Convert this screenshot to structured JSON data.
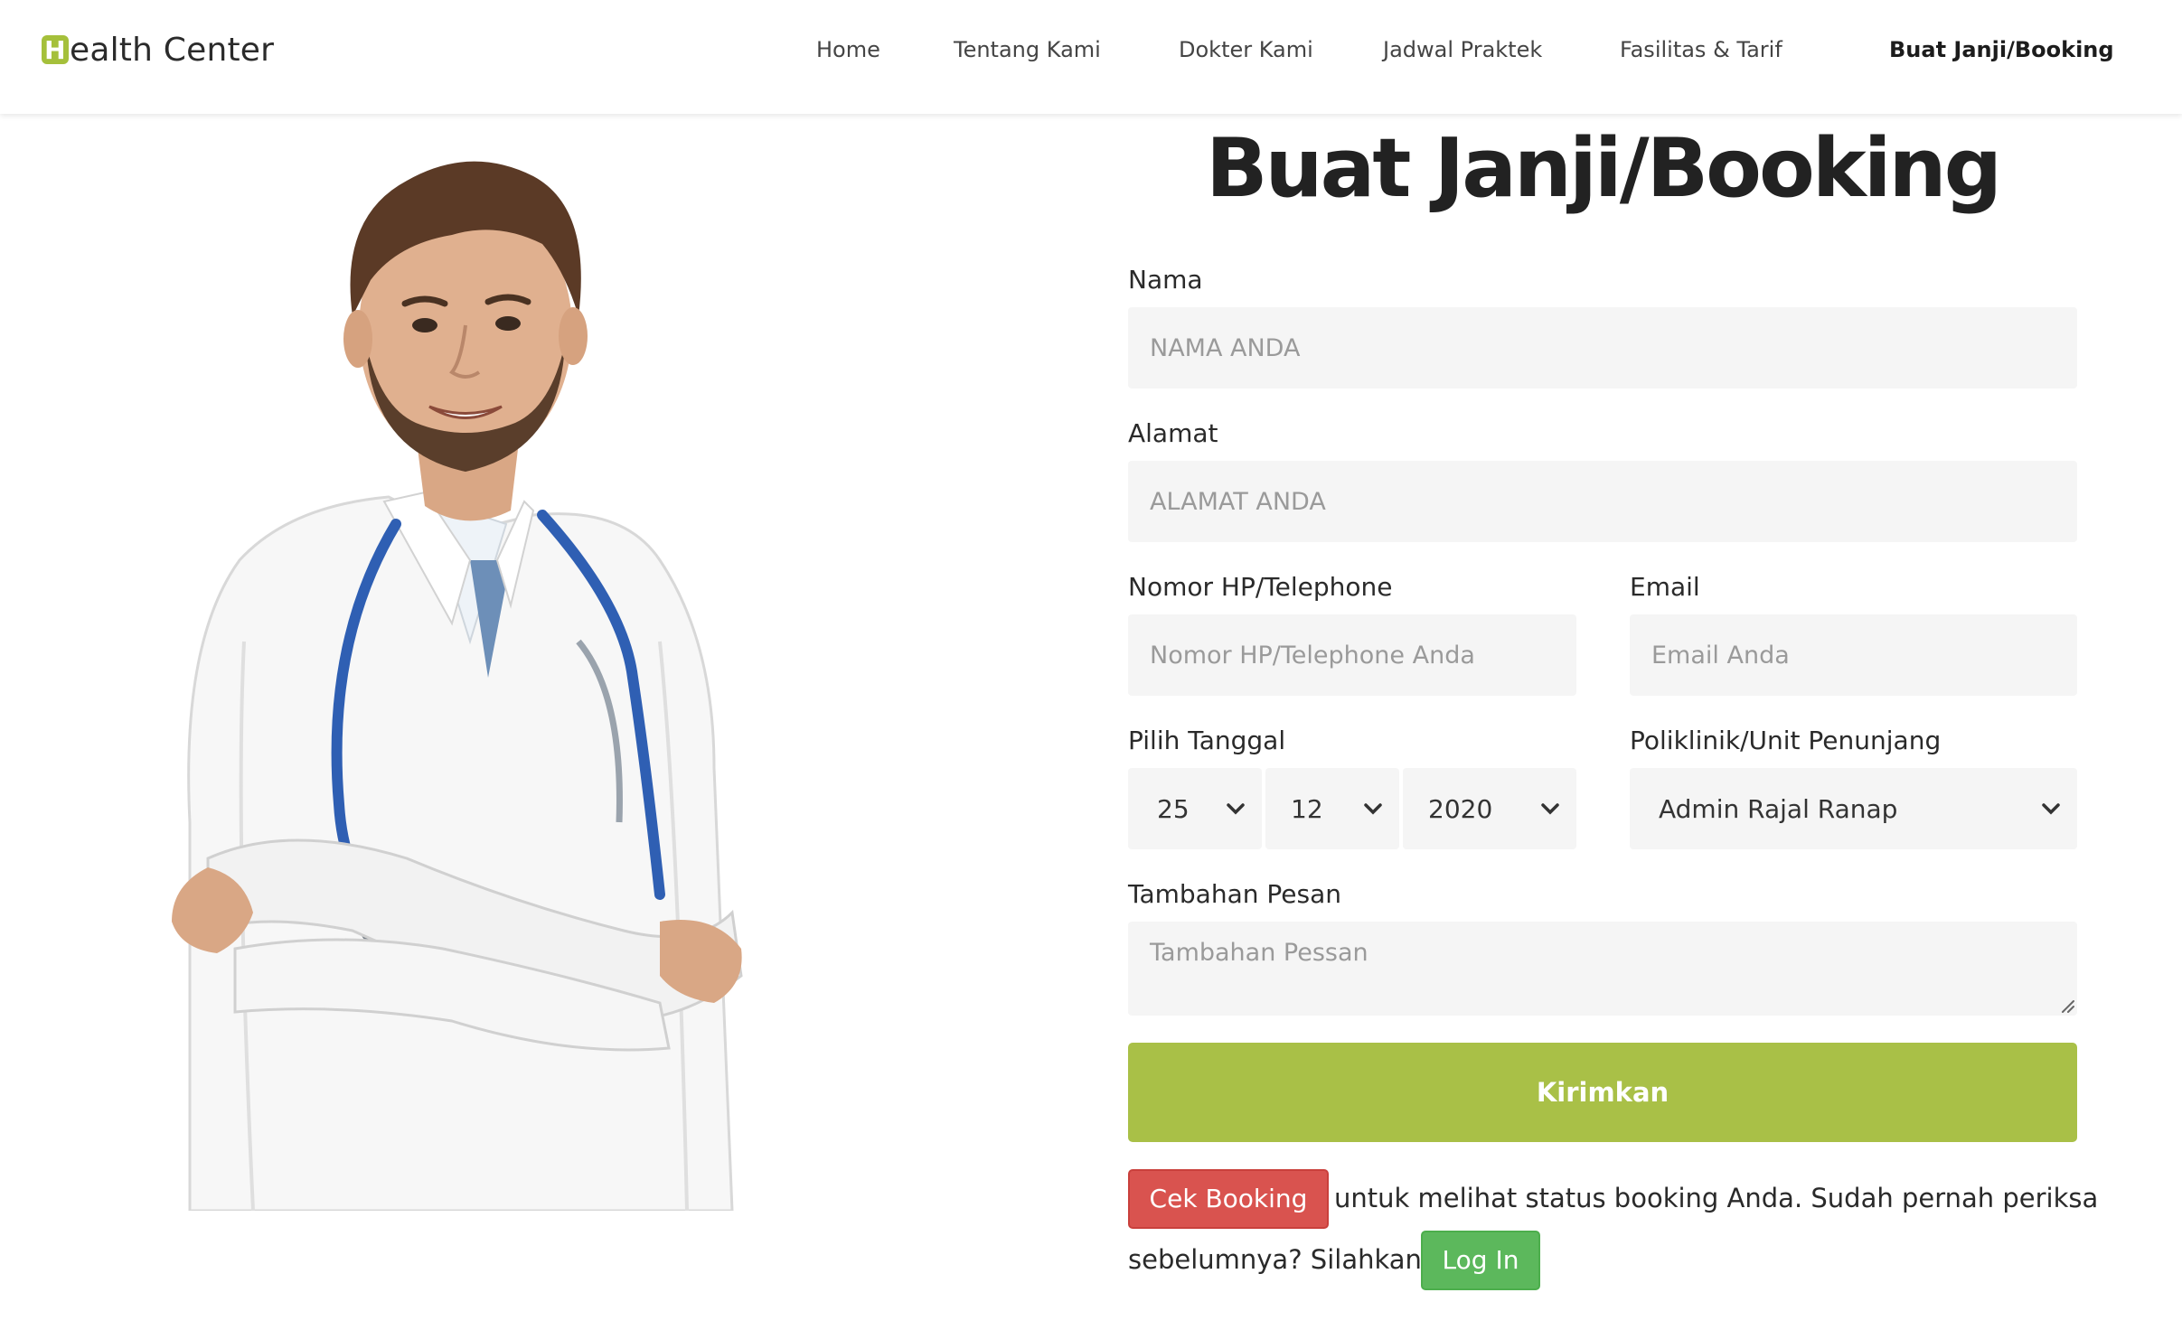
{
  "nav": {
    "brand_mark": "H",
    "brand_rest": "ealth Center",
    "items": [
      "Home",
      "Tentang Kami",
      "Dokter Kami",
      "Jadwal Praktek",
      "Fasilitas & Tarif",
      "Buat Janji/Booking"
    ],
    "active": "Buat Janji/Booking"
  },
  "form": {
    "title": "Buat Janji/Booking",
    "nama": {
      "label": "Nama",
      "placeholder": "NAMA ANDA"
    },
    "alamat": {
      "label": "Alamat",
      "placeholder": "ALAMAT ANDA"
    },
    "telepon": {
      "label": "Nomor HP/Telephone",
      "placeholder": "Nomor HP/Telephone Anda"
    },
    "email": {
      "label": "Email",
      "placeholder": "Email Anda"
    },
    "tanggal": {
      "label": "Pilih Tanggal",
      "day": "25",
      "month": "12",
      "year": "2020"
    },
    "poliklinik": {
      "label": "Poliklinik/Unit Penunjang",
      "selected": "Admin Rajal Ranap"
    },
    "pesan": {
      "label": "Tambahan Pesan",
      "placeholder": "Tambahan Pessan"
    },
    "submit_label": "Kirimkan"
  },
  "footer_note": {
    "cek_booking_label": "Cek Booking",
    "text_1": "untuk melihat status booking Anda. Sudah pernah periksa",
    "text_2": "sebelumnya? Silahkan",
    "login_label": "Log In"
  },
  "colors": {
    "brand_green": "#a5c03b",
    "submit_green": "#a9c047",
    "danger_red": "#d9534f",
    "success_green": "#5cb85c",
    "field_bg": "#f5f5f5"
  },
  "icons": [
    "chevron-down-icon",
    "resize-grip-icon"
  ]
}
